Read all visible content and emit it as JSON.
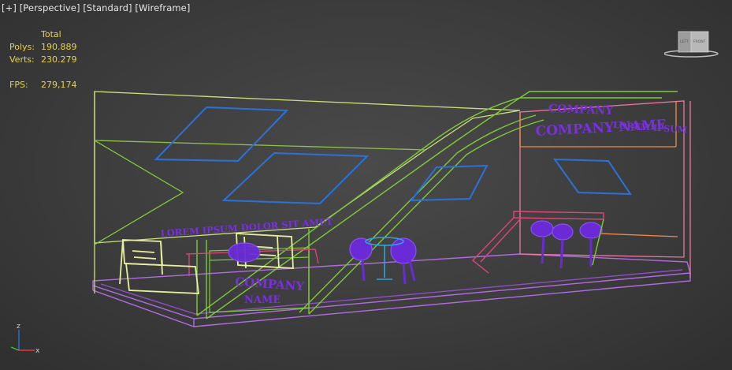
{
  "viewport": {
    "menu_plus": "[+]",
    "view": "[Perspective]",
    "shading_standard": "[Standard]",
    "shading_mode": "[Wireframe]"
  },
  "stats": {
    "header": "Total",
    "polys_label": "Polys:",
    "polys_value": "190.889",
    "verts_label": "Verts:",
    "verts_value": "230.279",
    "fps_label": "FPS:",
    "fps_value": "279,174"
  },
  "scene_text": {
    "company_top": "COMPANY",
    "company_name": "COMPANY NAME",
    "lorem_right": "LOREM IPSUM",
    "lorem_left": "LOREM IPSUM DOLOR SIT AMET",
    "counter_company": "COMPANY",
    "counter_name": "NAME"
  },
  "viewcube": {
    "left_face": "LEFT",
    "front_face": "FRONT"
  },
  "axis": {
    "z": "z",
    "x": "x"
  },
  "colors": {
    "background": "#3c3c3c",
    "wall_green": "#7ecb3a",
    "wall_yellowgreen": "#c9e07a",
    "panel_blue": "#2a72d9",
    "furniture_purple": "#6a2bd6",
    "text_purple": "#7a2fe0",
    "floor_violet": "#b06ce0",
    "counter_pink": "#e0457a",
    "table_cyan": "#2aa6d9",
    "stats_yellow": "#e6d24a"
  }
}
